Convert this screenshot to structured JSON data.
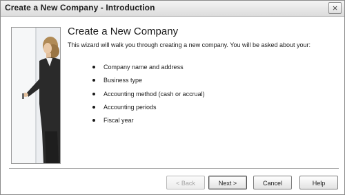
{
  "window": {
    "title": "Create a New Company - Introduction",
    "close_glyph": "×"
  },
  "content": {
    "heading": "Create a New Company",
    "intro": "This wizard will walk you through creating a new company.  You will be asked about your:",
    "bullets": [
      "Company name and address",
      "Business type",
      "Accounting method (cash or accrual)",
      "Accounting periods",
      "Fiscal year"
    ]
  },
  "buttons": {
    "back": "< Back",
    "next": "Next >",
    "cancel": "Cancel",
    "help": "Help"
  },
  "colors": {
    "title_bar": "#dcdcdc",
    "suit": "#2a2a2a",
    "hair": "#b08a56"
  }
}
